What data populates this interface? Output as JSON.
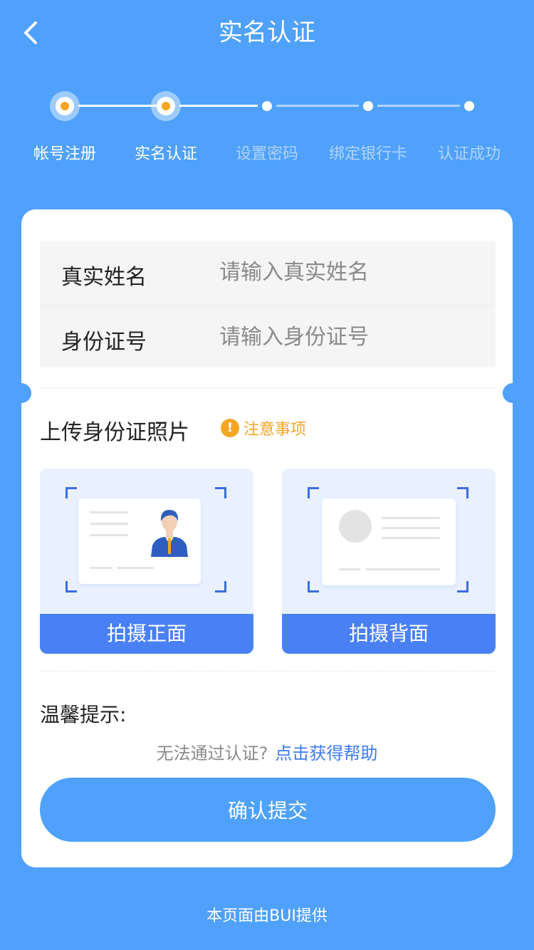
{
  "header": {
    "title": "实名认证",
    "back_icon": "chevron-left-icon"
  },
  "steps": [
    {
      "label": "帐号注册",
      "state": "done"
    },
    {
      "label": "实名认证",
      "state": "current"
    },
    {
      "label": "设置密码",
      "state": "todo"
    },
    {
      "label": "绑定银行卡",
      "state": "todo"
    },
    {
      "label": "认证成功",
      "state": "todo"
    }
  ],
  "form": {
    "name_label": "真实姓名",
    "name_placeholder": "请输入真实姓名",
    "name_value": "",
    "id_label": "身份证号",
    "id_placeholder": "请输入身份证号",
    "id_value": ""
  },
  "upload": {
    "title": "上传身份证照片",
    "notice_icon": "exclamation-circle-icon",
    "notice_label": "注意事项",
    "front_label": "拍摄正面",
    "back_label": "拍摄背面"
  },
  "tips": {
    "title": "温馨提示:",
    "question": "无法通过认证?",
    "help_link": "点击获得帮助"
  },
  "submit_label": "确认提交",
  "footer": "本页面由BUI提供",
  "colors": {
    "background": "#4fa1fb",
    "accent_orange": "#f5a524",
    "button_blue": "#4a80f5",
    "link_blue": "#3d7af0"
  }
}
